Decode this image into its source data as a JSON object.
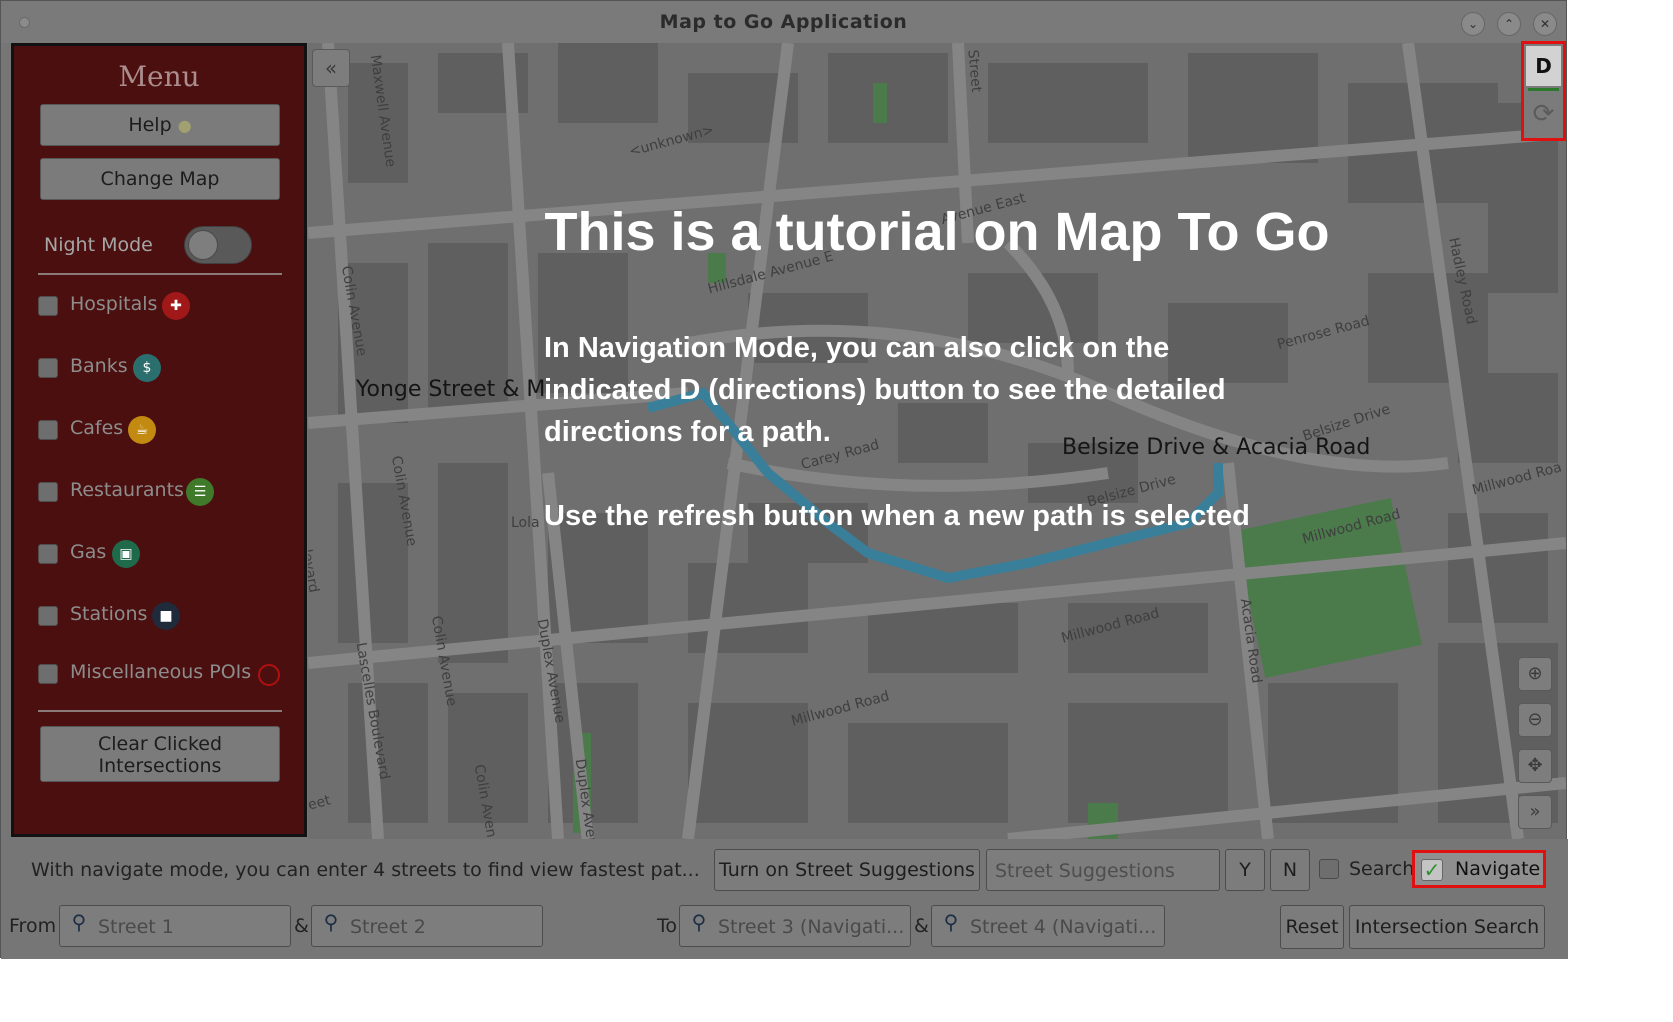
{
  "window": {
    "title": "Map to Go Application"
  },
  "sidebar": {
    "title": "Menu",
    "help_label": "Help",
    "change_map_label": "Change Map",
    "night_mode_label": "Night Mode",
    "pois": [
      {
        "label": "Hospitals",
        "icon": "hospital-icon",
        "color": "#a01818"
      },
      {
        "label": "Banks",
        "icon": "money-bag-icon",
        "color": "#2a6e6e"
      },
      {
        "label": "Cafes",
        "icon": "cup-icon",
        "color": "#c28a10"
      },
      {
        "label": "Restaurants",
        "icon": "utensils-icon",
        "color": "#3f7a2a"
      },
      {
        "label": "Gas",
        "icon": "gas-pump-icon",
        "color": "#1f6a4a"
      },
      {
        "label": "Stations",
        "icon": "train-icon",
        "color": "#1f2a3a"
      },
      {
        "label": "Miscellaneous POIs",
        "icon": "circle-icon",
        "color": "#b01010"
      }
    ],
    "clear_label_line1": "Clear Clicked",
    "clear_label_line2": "Intersections"
  },
  "map": {
    "streets": {
      "maxwell": "Maxwell Avenue",
      "street_top": "Street",
      "unknown": "<unknown>",
      "avenue_east": "Avenue East",
      "hillsdale": "Hillsdale Avenue E",
      "hadley": "Hadley Road",
      "colin1": "Colin Avenue",
      "penrose": "Penrose Road",
      "carey": "Carey Road",
      "belsize1": "Belsize Drive",
      "belsize2": "Belsize Drive",
      "millwood1": "Millwood Roa",
      "millwood2": "Millwood Road",
      "lola": "Lola",
      "colin2": "Colin Avenue",
      "evard": "levard",
      "colin3": "Colin Avenue",
      "lascelles": "Lascelles Boulevard",
      "duplex1": "Duplex Avenue",
      "millwood3": "Millwood Road",
      "acacia": "Acacia Road",
      "millwood4": "Millwood Road",
      "colin4": "Colin Aven",
      "duplex2": "Duplex Aver",
      "eet": "eet"
    },
    "intersection_start": "Yonge Street & M",
    "intersection_end": "Belsize Drive & Acacia Road",
    "route_color": "#3a7f99"
  },
  "tutorial": {
    "title": "This is a tutorial on Map To Go",
    "line1": "In Navigation Mode, you can also click on the",
    "line2": "indicated D (directions) button to see the detailed",
    "line3": "directions for a path.",
    "line4": "Use the refresh button when a new path is selected"
  },
  "directions_button": "D",
  "bottom": {
    "hint": "With navigate mode, you can enter 4 streets to find view fastest pat...",
    "street_suggestions_button": "Turn on Street Suggestions",
    "street_suggestions_placeholder": "Street Suggestions",
    "yes": "Y",
    "no": "N",
    "search_label": "Search",
    "navigate_label": "Navigate",
    "from_label": "From",
    "street1": "Street 1",
    "amp1": "&",
    "street2": "Street 2",
    "to_label": "To",
    "street3": "Street 3 (Navigati...",
    "amp2": "&",
    "street4": "Street 4 (Navigati...",
    "reset": "Reset",
    "intersection_search": "Intersection Search"
  }
}
